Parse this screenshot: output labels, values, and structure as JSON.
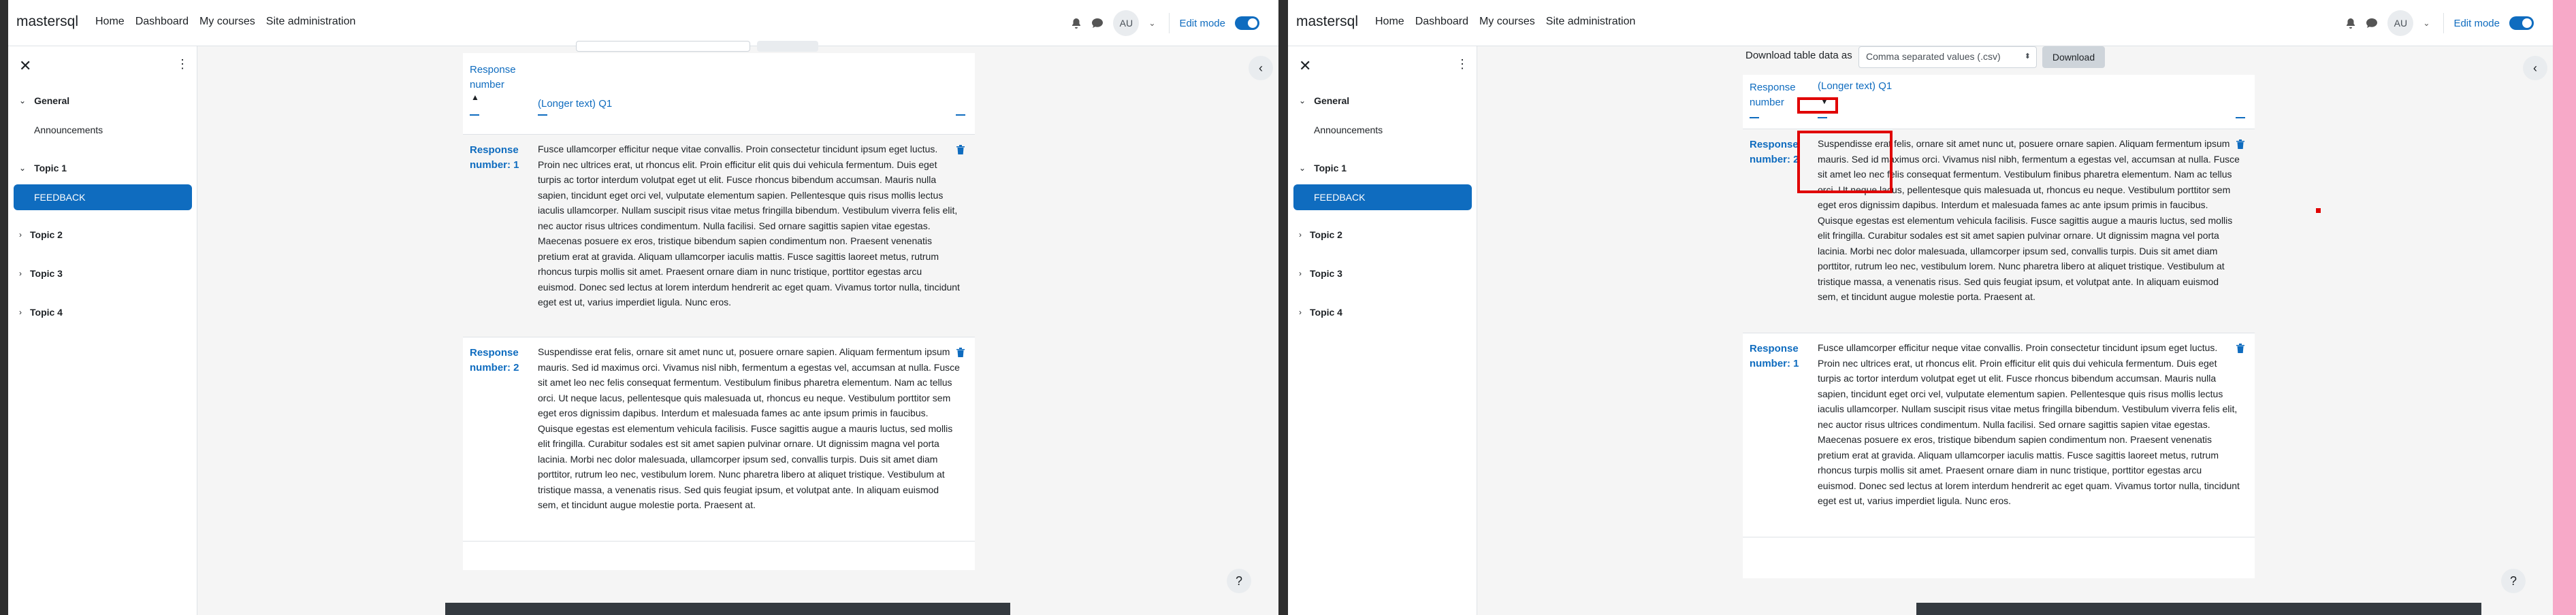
{
  "app": {
    "brand": "mastersql",
    "nav": [
      "Home",
      "Dashboard",
      "My courses",
      "Site administration"
    ],
    "user_initials": "AU",
    "edit_mode_label": "Edit mode"
  },
  "drawer": {
    "close_glyph": "✕",
    "kebab_glyph": "⋮",
    "sections": [
      {
        "label": "General",
        "items": [
          "Announcements"
        ]
      },
      {
        "label": "Topic 1",
        "items": [
          "FEEDBACK"
        ]
      },
      {
        "label": "Topic 2",
        "items": []
      },
      {
        "label": "Topic 3",
        "items": []
      },
      {
        "label": "Topic 4",
        "items": []
      }
    ],
    "active_item": "FEEDBACK"
  },
  "download": {
    "label": "Download table data as",
    "format_selected": "Comma separated values (.csv)",
    "button_label": "Download"
  },
  "table": {
    "col_response": "Response number",
    "col_longer": "(Longer text) Q1"
  },
  "responses": {
    "r1": {
      "label": "Response number: 1",
      "text": "Fusce ullamcorper efficitur neque vitae convallis. Proin consectetur tincidunt ipsum eget luctus. Proin nec ultrices erat, ut rhoncus elit. Proin efficitur elit quis dui vehicula fermentum. Duis eget turpis ac tortor interdum volutpat eget ut elit. Fusce rhoncus bibendum accumsan. Mauris nulla sapien, tincidunt eget orci vel, vulputate elementum sapien. Pellentesque quis risus mollis lectus iaculis ullamcorper. Nullam suscipit risus vitae metus fringilla bibendum. Vestibulum viverra felis elit, nec auctor risus ultrices condimentum. Nulla facilisi. Sed ornare sagittis sapien vitae egestas. Maecenas posuere ex eros, tristique bibendum sapien condimentum non. Praesent venenatis pretium erat at gravida. Aliquam ullamcorper iaculis mattis. Fusce sagittis laoreet metus, rutrum rhoncus turpis mollis sit amet. Praesent ornare diam in nunc tristique, porttitor egestas arcu euismod. Donec sed lectus at lorem interdum hendrerit ac eget quam. Vivamus tortor nulla, tincidunt eget est ut, varius imperdiet ligula. Nunc eros."
    },
    "r2": {
      "label": "Response number: 2",
      "text": "Suspendisse erat felis, ornare sit amet nunc ut, posuere ornare sapien. Aliquam fermentum ipsum mauris. Sed id maximus orci. Vivamus nisl nibh, fermentum a egestas vel, accumsan at nulla. Fusce sit amet leo nec felis consequat fermentum. Vestibulum finibus pharetra elementum. Nam ac tellus orci. Ut neque lacus, pellentesque quis malesuada ut, rhoncus eu neque. Vestibulum porttitor sem eget eros dignissim dapibus. Interdum et malesuada fames ac ante ipsum primis in faucibus. Quisque egestas est elementum vehicula facilisis. Fusce sagittis augue a mauris luctus, sed mollis elit fringilla. Curabitur sodales est sit amet sapien pulvinar ornare. Ut dignissim magna vel porta lacinia. Morbi nec dolor malesuada, ullamcorper ipsum sed, convallis turpis. Duis sit amet diam porttitor, rutrum leo nec, vestibulum lorem. Nunc pharetra libero at aliquet tristique. Vestibulum at tristique massa, a venenatis risus. Sed quis feugiat ipsum, et volutpat ante. In aliquam euismod sem, et tincidunt augue molestie porta. Praesent at."
    }
  },
  "help_glyph": "?",
  "icons": [
    "bell-icon",
    "chat-icon",
    "chevron-down-icon",
    "close-icon",
    "kebab-icon",
    "chevron-left-icon",
    "trash-icon",
    "sort-up-icon",
    "sort-down-icon",
    "help-icon"
  ],
  "colors": {
    "accent": "#0f6cbf",
    "annotation": "#e00000"
  }
}
